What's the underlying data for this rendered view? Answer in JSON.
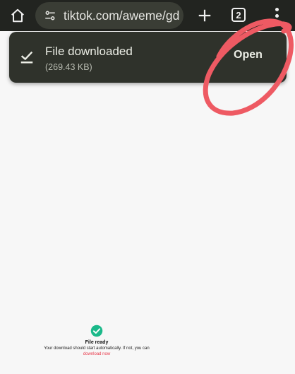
{
  "browser": {
    "url": "tiktok.com/aweme/gd",
    "tab_count": "2"
  },
  "snackbar": {
    "title": "File downloaded",
    "size": "(269.43 KB)",
    "action_label": "Open"
  },
  "page": {
    "ready_title": "File ready",
    "ready_message": "Your download should start automatically. If not, you can",
    "download_link": "download now"
  },
  "colors": {
    "toolbar_bg": "#222420",
    "snackbar_bg": "#2f322b",
    "annotation": "#ee5a63",
    "success": "#1bb98a",
    "link": "#e8394a"
  },
  "icons": {
    "home": "home-icon",
    "site_settings": "tune-icon",
    "new_tab": "plus-icon",
    "menu": "more-vert-icon",
    "download_done": "download-done-icon",
    "ready": "check-circle-icon"
  }
}
